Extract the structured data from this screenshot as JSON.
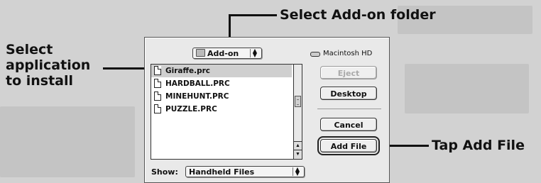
{
  "callouts": {
    "folder": "Select Add-on folder",
    "app_line1": "Select",
    "app_line2": "application",
    "app_line3": "to install",
    "add": "Tap Add File"
  },
  "dialog": {
    "folder_popup": "Add-on",
    "volume": "Macintosh HD",
    "files": [
      "Giraffe.prc",
      "HARDBALL.PRC",
      "MINEHUNT.PRC",
      "PUZZLE.PRC"
    ],
    "selected_file": "Giraffe.prc",
    "buttons": {
      "eject": "Eject",
      "desktop": "Desktop",
      "cancel": "Cancel",
      "add_file": "Add File"
    },
    "show_label": "Show:",
    "show_value": "Handheld Files"
  },
  "icons": {
    "up_arrow": "▲",
    "down_arrow": "▼",
    "popup_arrows": "▲▼"
  }
}
